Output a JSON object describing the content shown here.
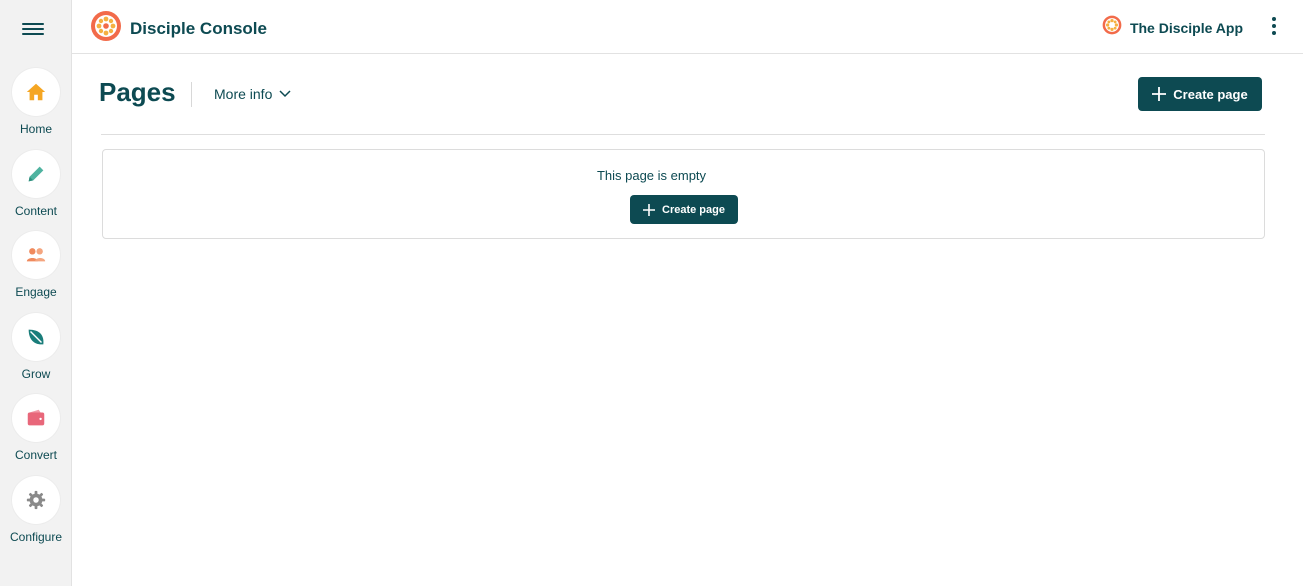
{
  "sidebar": {
    "items": [
      {
        "label": "Home",
        "icon": "home-icon",
        "color": "#f5a623"
      },
      {
        "label": "Content",
        "icon": "pencil-icon",
        "color": "#4fb3a0"
      },
      {
        "label": "Engage",
        "icon": "people-icon",
        "color": "#f08a5d"
      },
      {
        "label": "Grow",
        "icon": "leaf-icon",
        "color": "#1a7d7a"
      },
      {
        "label": "Convert",
        "icon": "wallet-icon",
        "color": "#e8677a"
      },
      {
        "label": "Configure",
        "icon": "gear-icon",
        "color": "#8a8a8a"
      }
    ]
  },
  "header": {
    "brand_title": "Disciple Console",
    "app_name": "The Disciple App"
  },
  "page": {
    "title": "Pages",
    "more_info": "More info",
    "create_button": "Create page",
    "empty_text": "This page is empty",
    "empty_create_button": "Create page"
  },
  "colors": {
    "primary": "#0d4a52",
    "brand_orange": "#f26b4a"
  }
}
